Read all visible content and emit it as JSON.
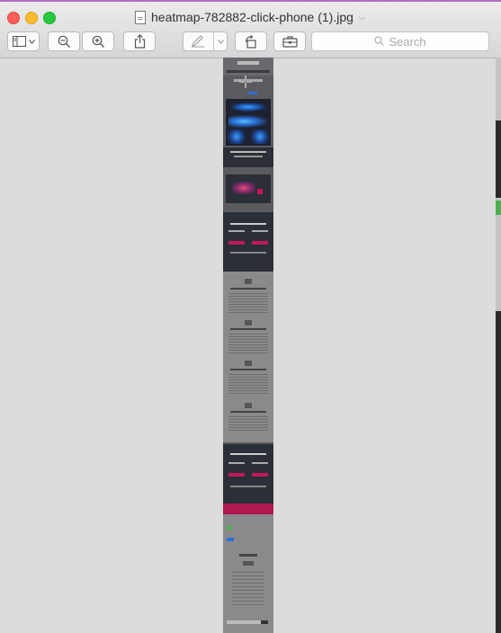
{
  "window": {
    "filename": "heatmap-782882-click-phone (1).jpg",
    "filename_chevron": "⌵"
  },
  "toolbar": {
    "buttons": [
      {
        "name": "sidebar-toggle",
        "icon": "sidebar-icon"
      },
      {
        "name": "zoom-out",
        "icon": "zoom-out-icon"
      },
      {
        "name": "zoom-in",
        "icon": "zoom-in-icon"
      },
      {
        "name": "share",
        "icon": "share-icon"
      },
      {
        "name": "markup",
        "icon": "pen-icon"
      },
      {
        "name": "rotate",
        "icon": "rotate-icon"
      },
      {
        "name": "toolbox",
        "icon": "toolbox-icon"
      }
    ],
    "search_placeholder": "Search"
  },
  "colors": {
    "viewer_bg": "#dcdcdc",
    "doc_gray": "#5b5b5f",
    "doc_dark": "#2b2f37",
    "doc_light": "#8a8a8c",
    "accent_red": "#c2185b",
    "heat_blue": "#2a6fd6"
  }
}
